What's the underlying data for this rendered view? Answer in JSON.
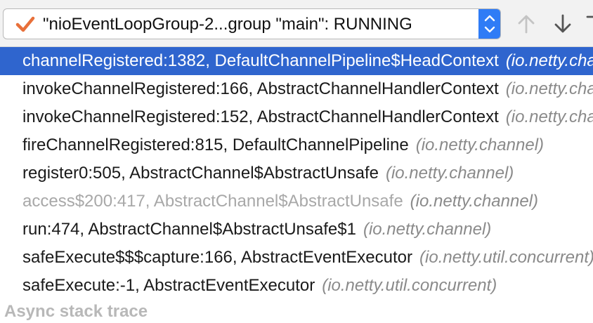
{
  "toolbar": {
    "thread_label": "\"nioEventLoopGroup-2...group \"main\": RUNNING"
  },
  "frames": [
    {
      "method": "channelRegistered:1382, DefaultChannelPipeline$HeadContext",
      "package": "(io.netty.channel)",
      "selected": true,
      "dimmed": false
    },
    {
      "method": "invokeChannelRegistered:166, AbstractChannelHandlerContext",
      "package": "(io.netty.channel)",
      "selected": false,
      "dimmed": false
    },
    {
      "method": "invokeChannelRegistered:152, AbstractChannelHandlerContext",
      "package": "(io.netty.channel)",
      "selected": false,
      "dimmed": false
    },
    {
      "method": "fireChannelRegistered:815, DefaultChannelPipeline",
      "package": "(io.netty.channel)",
      "selected": false,
      "dimmed": false
    },
    {
      "method": "register0:505, AbstractChannel$AbstractUnsafe",
      "package": "(io.netty.channel)",
      "selected": false,
      "dimmed": false
    },
    {
      "method": "access$200:417, AbstractChannel$AbstractUnsafe",
      "package": "(io.netty.channel)",
      "selected": false,
      "dimmed": true
    },
    {
      "method": "run:474, AbstractChannel$AbstractUnsafe$1",
      "package": "(io.netty.channel)",
      "selected": false,
      "dimmed": false
    },
    {
      "method": "safeExecute$$$capture:166, AbstractEventExecutor",
      "package": "(io.netty.util.concurrent)",
      "selected": false,
      "dimmed": false
    },
    {
      "method": "safeExecute:-1, AbstractEventExecutor",
      "package": "(io.netty.util.concurrent)",
      "selected": false,
      "dimmed": false
    }
  ],
  "async_label": "Async stack trace",
  "colors": {
    "selection": "#2f65ce",
    "stepper": "#2f7cf6",
    "check": "#e8703a",
    "package_text": "#8a8a8a"
  }
}
